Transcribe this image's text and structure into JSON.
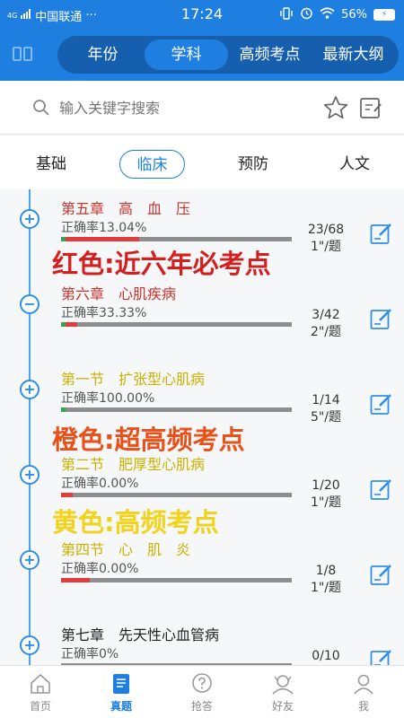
{
  "status_bar": {
    "signal": "4G",
    "carrier": "中国联通",
    "dots": "···",
    "time": "17:24",
    "battery": "56%"
  },
  "header": {
    "menu_icon": "columns-icon",
    "tabs": [
      {
        "label": "年份",
        "active": false
      },
      {
        "label": "学科",
        "active": true
      },
      {
        "label": "高频考点",
        "active": false
      },
      {
        "label": "最新大纲",
        "active": false
      }
    ]
  },
  "search": {
    "placeholder": "输入关键字搜索",
    "icon": "search-icon",
    "favorite_icon": "star-icon",
    "notes_icon": "note-edit-icon"
  },
  "subjects": [
    {
      "label": "基础",
      "active": false
    },
    {
      "label": "临床",
      "active": true
    },
    {
      "label": "预防",
      "active": false
    },
    {
      "label": "人文",
      "active": false
    }
  ],
  "colors": {
    "primary": "#1f7fe0",
    "red": "#d7332f",
    "orange": "#e8581e",
    "yellow": "#c9b100",
    "progress_green": "#2fa84f",
    "progress_red": "#e23b3b"
  },
  "items": [
    {
      "title": "第五章　高　血　压",
      "color": "#c8332c",
      "accuracy": "正确率13.04%",
      "count": "23/68",
      "time": "1\"/题",
      "expand": "+",
      "green": 0.02,
      "red_to": 0.34
    },
    {
      "title": "第六章　心肌疾病",
      "color": "#c8332c",
      "accuracy": "正确率33.33%",
      "count": "3/42",
      "time": "2\"/题",
      "expand": "−",
      "green": 0.02,
      "red_to": 0.07
    },
    {
      "title": "第一节　扩张型心肌病",
      "color": "#c9b100",
      "accuracy": "正确率100.00%",
      "count": "1/14",
      "time": "5\"/题",
      "expand": "+",
      "green": 0.02,
      "red_to": 0.02
    },
    {
      "title": "第二节　肥厚型心肌病",
      "color": "#c9b100",
      "accuracy": "正确率0.00%",
      "count": "1/20",
      "time": "1\"/题",
      "expand": "+",
      "green": 0,
      "red_to": 0.05
    },
    {
      "title": "第四节　心　肌　炎",
      "color": "#c9b100",
      "accuracy": "正确率0.00%",
      "count": "1/8",
      "time": "1\"/题",
      "expand": "+",
      "green": 0,
      "red_to": 0.125
    },
    {
      "title": "第七章　先天性心血管病",
      "color": "#222222",
      "accuracy": "正确率0%",
      "count": "0/10",
      "time": "",
      "expand": "+",
      "green": 0,
      "red_to": 0
    }
  ],
  "overlay_labels": [
    {
      "text": "红色:近六年必考点",
      "color": "#d41f1f"
    },
    {
      "text": "橙色:超高频考点",
      "color": "#e8521a"
    },
    {
      "text": "黄色:高频考点",
      "color": "#f2d21a"
    }
  ],
  "bottom_tabs": [
    {
      "label": "首页",
      "icon": "home-icon",
      "active": false
    },
    {
      "label": "真题",
      "icon": "book-icon",
      "active": true
    },
    {
      "label": "抢答",
      "icon": "question-icon",
      "active": false
    },
    {
      "label": "好友",
      "icon": "friends-icon",
      "active": false
    },
    {
      "label": "我",
      "icon": "user-icon",
      "active": false
    }
  ]
}
